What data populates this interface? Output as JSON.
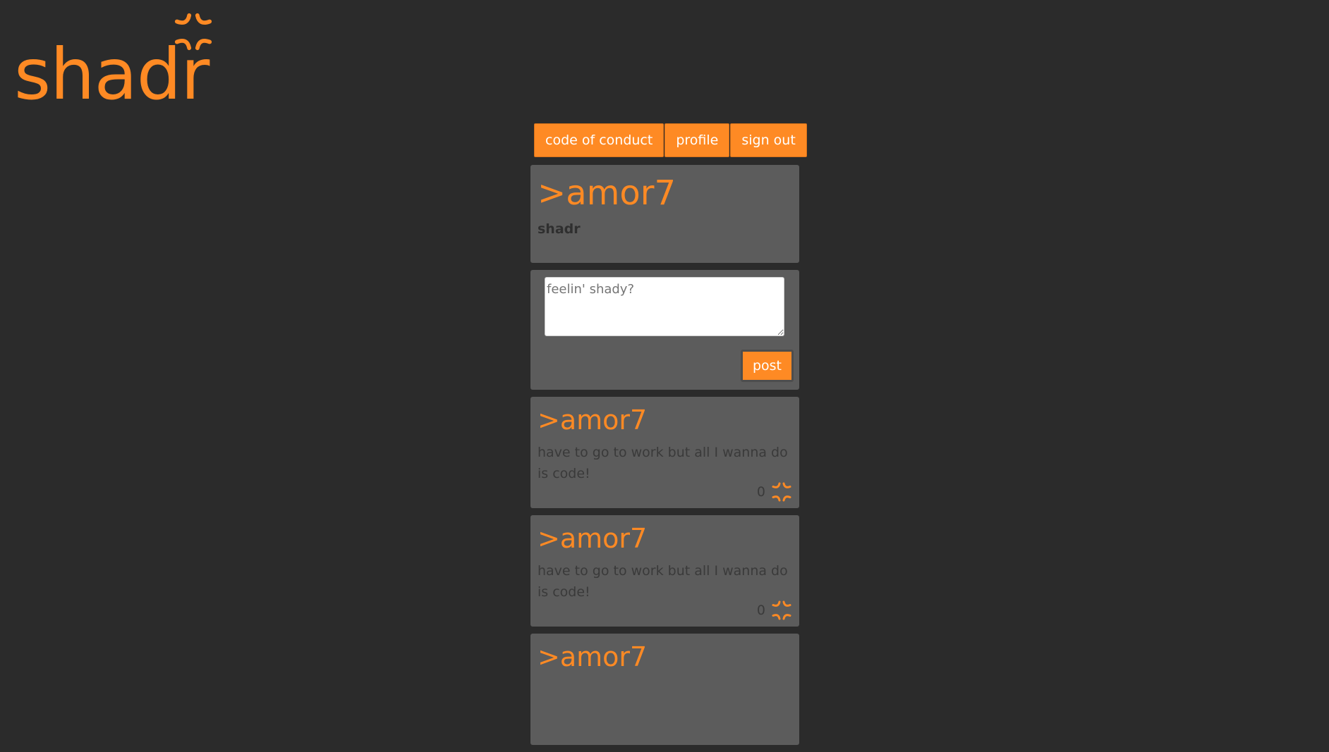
{
  "brand": {
    "name": "shadr",
    "accent_color": "#fe8a24",
    "mark_icon": "anger-symbol-icon"
  },
  "nav": {
    "items": [
      {
        "label": "code of conduct"
      },
      {
        "label": "profile"
      },
      {
        "label": "sign out"
      }
    ]
  },
  "profile": {
    "handle": ">amor7",
    "subtitle": "shadr"
  },
  "compose": {
    "placeholder": "feelin' shady?",
    "post_label": "post"
  },
  "posts": [
    {
      "handle": ">amor7",
      "body": "have to go to work but all I wanna do is code!",
      "count": "0",
      "icon": "anger-symbol-icon"
    },
    {
      "handle": ">amor7",
      "body": "have to go to work but all I wanna do is code!",
      "count": "0",
      "icon": "anger-symbol-icon"
    },
    {
      "handle": ">amor7",
      "body": "",
      "count": "",
      "icon": "anger-symbol-icon"
    }
  ]
}
